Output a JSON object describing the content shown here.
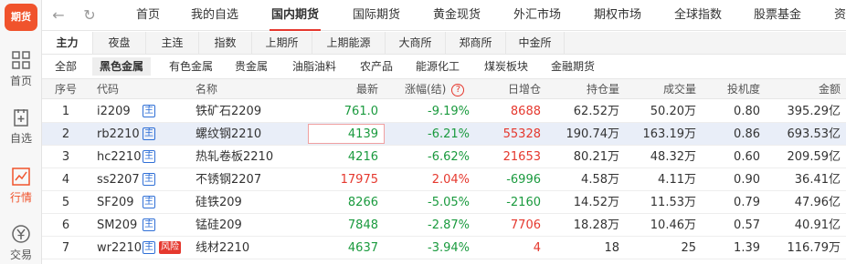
{
  "sidebar": {
    "logo": "期货",
    "items": [
      {
        "label": "首页"
      },
      {
        "label": "自选"
      },
      {
        "label": "行情"
      },
      {
        "label": "交易"
      }
    ]
  },
  "nav": {
    "tabs": [
      "首页",
      "我的自选",
      "国内期货",
      "国际期货",
      "黄金现货",
      "外汇市场",
      "期权市场",
      "全球指数",
      "股票基金",
      "资"
    ]
  },
  "subtabs": [
    "主力",
    "夜盘",
    "主连",
    "指数",
    "上期所",
    "上期能源",
    "大商所",
    "郑商所",
    "中金所"
  ],
  "categories": [
    "全部",
    "黑色金属",
    "有色金属",
    "贵金属",
    "油脂油料",
    "农产品",
    "能源化工",
    "煤炭板块",
    "金融期货"
  ],
  "table": {
    "headers": {
      "no": "序号",
      "code": "代码",
      "name": "名称",
      "last": "最新",
      "chg": "涨幅(结)",
      "help": "?",
      "oi_chg": "日增仓",
      "oi": "持仓量",
      "vol": "成交量",
      "spec": "投机度",
      "amount": "金额"
    },
    "badge": "主",
    "risk": "风险",
    "rows": [
      {
        "no": "1",
        "code": "i2209",
        "name": "铁矿石2209",
        "last": "761.0",
        "chg": "-9.19%",
        "oi_chg": "8688",
        "oi": "62.52万",
        "vol": "50.20万",
        "spec": "0.80",
        "amount": "395.29亿"
      },
      {
        "no": "2",
        "code": "rb2210",
        "name": "螺纹钢2210",
        "last": "4139",
        "chg": "-6.21%",
        "oi_chg": "55328",
        "oi": "190.74万",
        "vol": "163.19万",
        "spec": "0.86",
        "amount": "693.53亿"
      },
      {
        "no": "3",
        "code": "hc2210",
        "name": "热轧卷板2210",
        "last": "4216",
        "chg": "-6.62%",
        "oi_chg": "21653",
        "oi": "80.21万",
        "vol": "48.32万",
        "spec": "0.60",
        "amount": "209.59亿"
      },
      {
        "no": "4",
        "code": "ss2207",
        "name": "不锈钢2207",
        "last": "17975",
        "chg": "2.04%",
        "oi_chg": "-6996",
        "oi": "4.58万",
        "vol": "4.11万",
        "spec": "0.90",
        "amount": "36.41亿"
      },
      {
        "no": "5",
        "code": "SF209",
        "name": "硅铁209",
        "last": "8266",
        "chg": "-5.05%",
        "oi_chg": "-2160",
        "oi": "14.52万",
        "vol": "11.53万",
        "spec": "0.79",
        "amount": "47.96亿"
      },
      {
        "no": "6",
        "code": "SM209",
        "name": "锰硅209",
        "last": "7848",
        "chg": "-2.87%",
        "oi_chg": "7706",
        "oi": "18.28万",
        "vol": "10.46万",
        "spec": "0.57",
        "amount": "40.91亿"
      },
      {
        "no": "7",
        "code": "wr2210",
        "name": "线材2210",
        "last": "4637",
        "chg": "-3.94%",
        "oi_chg": "4",
        "oi": "18",
        "vol": "25",
        "spec": "1.39",
        "amount": "116.79万"
      }
    ]
  }
}
